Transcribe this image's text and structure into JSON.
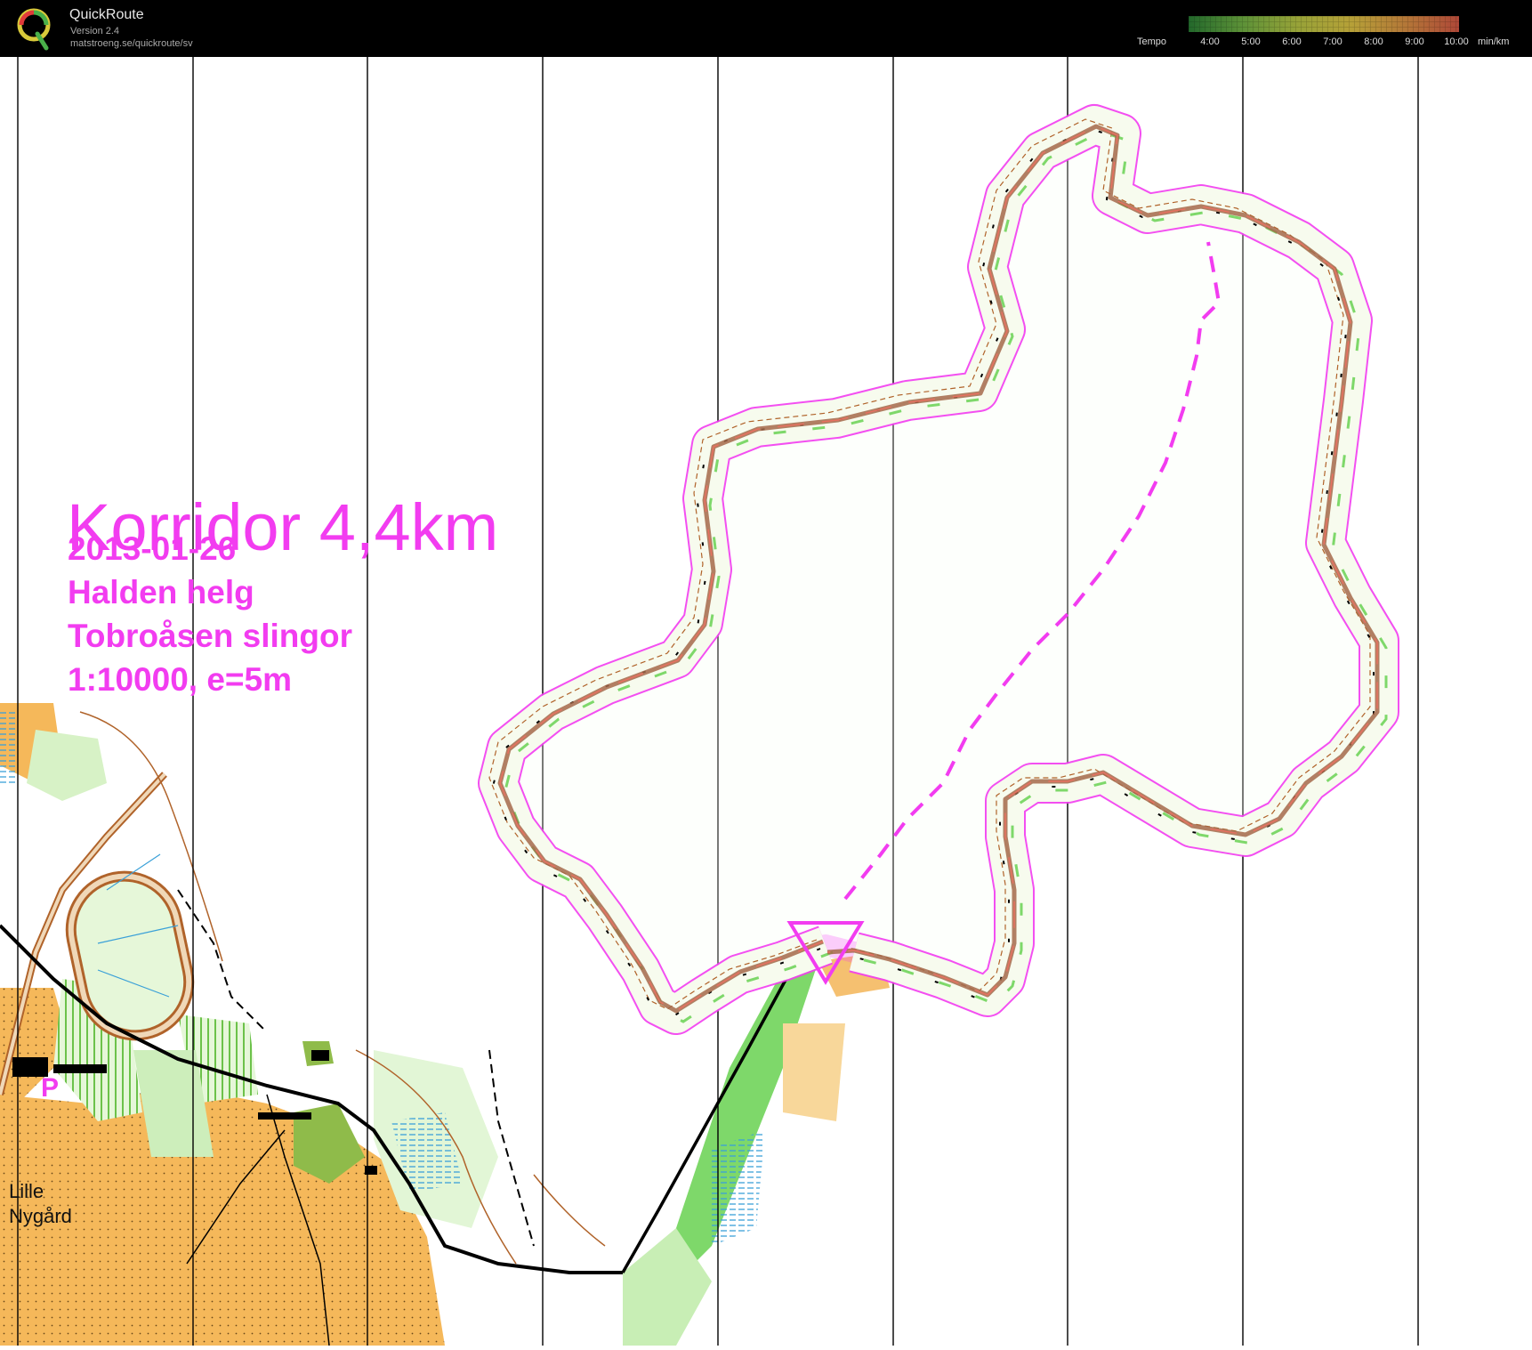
{
  "app": {
    "name": "QuickRoute",
    "version": "Version 2.4",
    "url": "matstroeng.se/quickroute/sv",
    "logo_letter": "Q"
  },
  "tempo_scale": {
    "label": "Tempo",
    "ticks": [
      "4:00",
      "5:00",
      "6:00",
      "7:00",
      "8:00",
      "9:00",
      "10:00"
    ],
    "unit": "min/km",
    "colors": [
      "#2e8b3a",
      "#7cc24a",
      "#c9d84a",
      "#f2d64a",
      "#f0a04a",
      "#e8604a",
      "#d8284a"
    ]
  },
  "map_text": {
    "title": "Korridor 4,4km",
    "info_lines": [
      "2013-01-26",
      "Halden helg",
      "Tobroåsen slingor",
      "1:10000, e=5m"
    ],
    "place_name_lines": [
      "Lille",
      "Nygård"
    ],
    "parking_symbol": "P"
  },
  "colors": {
    "course_magenta": "#f23cf0",
    "open_land": "#f5b85a",
    "green_vegetation": "#8bd46a",
    "contour_brown": "#b0632a",
    "water_blue": "#3aa0d8"
  }
}
